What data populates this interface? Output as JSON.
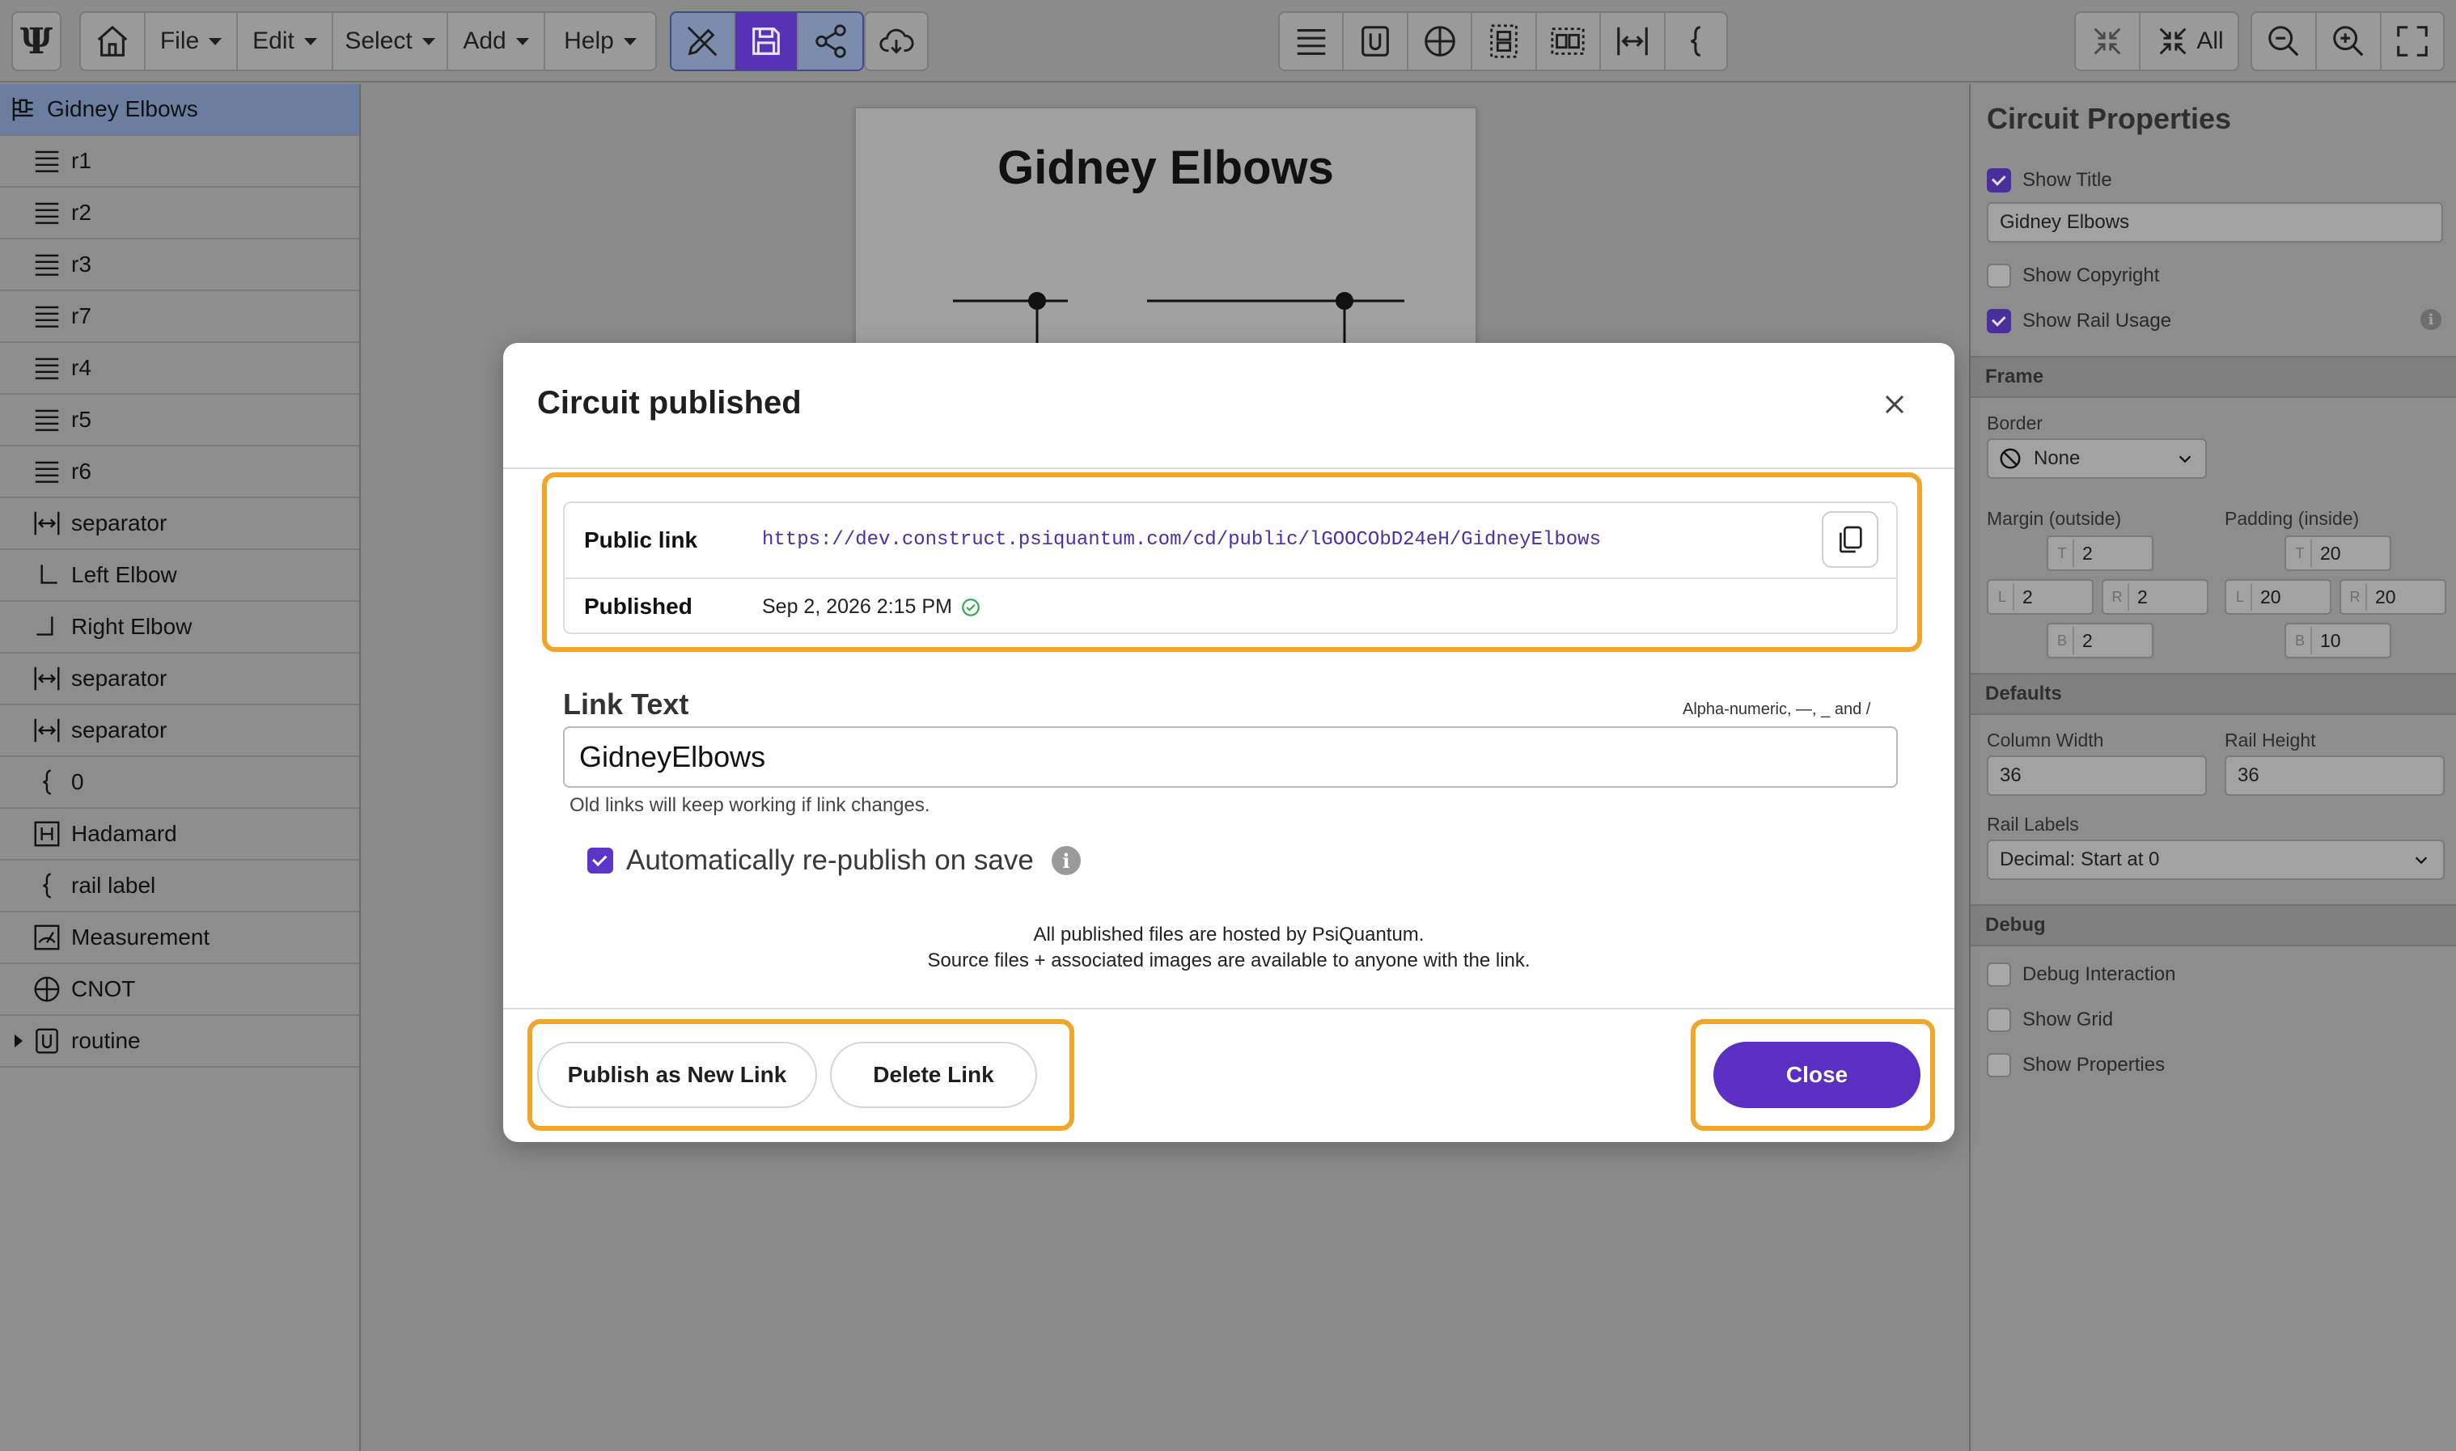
{
  "toolbar": {
    "menus": [
      "File",
      "Edit",
      "Select",
      "Add",
      "Help"
    ],
    "all_label": "All"
  },
  "sidebar": {
    "root": "Gidney Elbows",
    "items": [
      {
        "label": "r1",
        "icon": "rail-icon"
      },
      {
        "label": "r2",
        "icon": "rail-icon"
      },
      {
        "label": "r3",
        "icon": "rail-icon"
      },
      {
        "label": "r7",
        "icon": "rail-icon"
      },
      {
        "label": "r4",
        "icon": "rail-icon"
      },
      {
        "label": "r5",
        "icon": "rail-icon"
      },
      {
        "label": "r6",
        "icon": "rail-icon"
      },
      {
        "label": "separator",
        "icon": "separator-icon"
      },
      {
        "label": "Left Elbow",
        "icon": "left-elbow-icon"
      },
      {
        "label": "Right Elbow",
        "icon": "right-elbow-icon"
      },
      {
        "label": "separator",
        "icon": "separator-icon"
      },
      {
        "label": "separator",
        "icon": "separator-icon"
      },
      {
        "label": "0",
        "icon": "brace-icon"
      },
      {
        "label": "Hadamard",
        "icon": "hadamard-icon"
      },
      {
        "label": "rail label",
        "icon": "brace-icon"
      },
      {
        "label": "Measurement",
        "icon": "measurement-icon"
      },
      {
        "label": "CNOT",
        "icon": "cnot-icon"
      },
      {
        "label": "routine",
        "icon": "routine-icon"
      }
    ]
  },
  "canvas": {
    "title": "Gidney Elbows"
  },
  "properties": {
    "title": "Circuit Properties",
    "show_title": {
      "label": "Show Title",
      "checked": true
    },
    "title_value": "Gidney Elbows",
    "show_copyright": {
      "label": "Show Copyright",
      "checked": false
    },
    "show_rail_usage": {
      "label": "Show Rail Usage",
      "checked": true
    },
    "frame": {
      "heading": "Frame",
      "border_label": "Border",
      "border_value": "None",
      "margin_label": "Margin (outside)",
      "padding_label": "Padding (inside)",
      "margin": {
        "T": "2",
        "L": "2",
        "R": "2",
        "B": "2"
      },
      "padding": {
        "T": "20",
        "L": "20",
        "R": "20",
        "B": "10"
      }
    },
    "defaults": {
      "heading": "Defaults",
      "column_width_label": "Column Width",
      "column_width": "36",
      "rail_height_label": "Rail Height",
      "rail_height": "36",
      "rail_labels_label": "Rail Labels",
      "rail_labels_value": "Decimal: Start at 0"
    },
    "debug": {
      "heading": "Debug",
      "items": [
        {
          "label": "Debug Interaction",
          "checked": false
        },
        {
          "label": "Show Grid",
          "checked": false
        },
        {
          "label": "Show Properties",
          "checked": false
        }
      ]
    }
  },
  "modal": {
    "title": "Circuit published",
    "public_link_label": "Public link",
    "public_link": "https://dev.construct.psiquantum.com/cd/public/lGOOCObD24eH/GidneyElbows",
    "published_label": "Published",
    "published_date": "Sep 2, 2026 2:15 PM",
    "link_text_label": "Link Text",
    "link_text_hint": "Alpha-numeric, —, _ and /",
    "link_text_value": "GidneyElbows",
    "link_text_sub": "Old links will keep working if link changes.",
    "auto_republish": {
      "label": "Automatically re-publish on save",
      "checked": true
    },
    "hosted_line1": "All published files are hosted by PsiQuantum.",
    "hosted_line2": "Source files + associated images are available to anyone with the link.",
    "publish_new_label": "Publish as New Link",
    "delete_label": "Delete Link",
    "close_label": "Close"
  },
  "colors": {
    "accent": "#5a2fc2",
    "highlight": "#f0a52b",
    "link": "#4a2fa5"
  }
}
